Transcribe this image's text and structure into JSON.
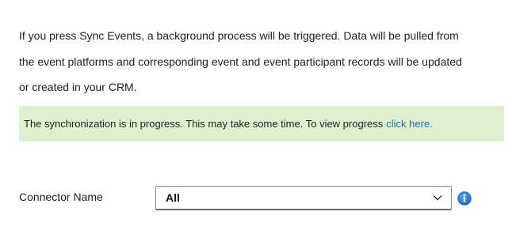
{
  "intro": {
    "line1": "If you press Sync Events, a background process will be triggered. Data will be pulled from",
    "line2": "the event platforms and corresponding event and event participant records will be updated",
    "line3": "or created in your CRM."
  },
  "status_banner": {
    "message": "The synchronization is in progress. This may take some time. To view progress",
    "link_text": "click here."
  },
  "connector": {
    "label": "Connector Name",
    "selected_value": "All",
    "dropdown_icon": "chevron-down-icon",
    "info_icon": "info-icon"
  },
  "colors": {
    "banner_background": "#dff0d0",
    "link": "#1a73b5",
    "info_icon": "#1a6fc4"
  }
}
